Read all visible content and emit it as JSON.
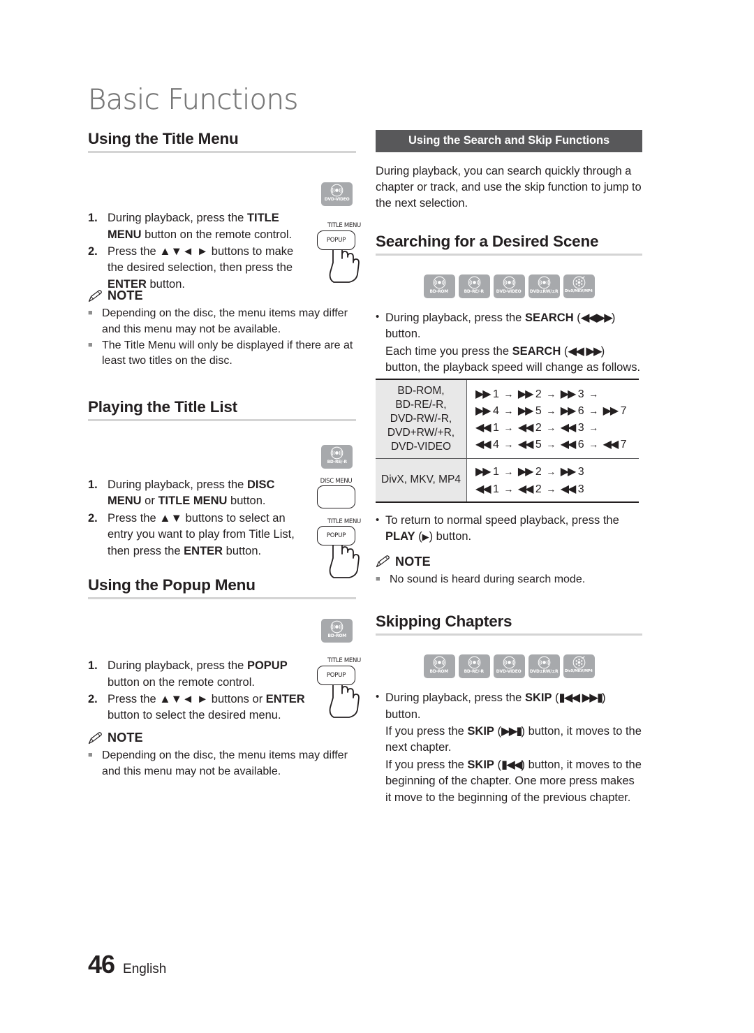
{
  "chapter": {
    "title": "Basic Functions"
  },
  "footer": {
    "page_number": "46",
    "language": "English"
  },
  "left_column": {
    "section1": {
      "heading": "Using the Title Menu",
      "disc_badge": {
        "caption": "DVD-VIDEO",
        "icon": "disc-icon"
      },
      "remote": {
        "cap": "TITLE MENU",
        "key_label": "POPUP",
        "icon": "hand-pressing-button-icon"
      },
      "steps": [
        {
          "num": "1.",
          "parts": [
            {
              "t": "During playback, press the "
            },
            {
              "t": "TITLE MENU",
              "b": true
            },
            {
              "t": " button on the remote control."
            }
          ]
        },
        {
          "num": "2.",
          "parts": [
            {
              "t": "Press the "
            },
            {
              "t": "▲▼◄ ►",
              "b": true
            },
            {
              "t": " buttons to make the desired selection, then press the "
            },
            {
              "t": "ENTER",
              "b": true
            },
            {
              "t": " button."
            }
          ]
        }
      ],
      "note": {
        "label": "NOTE",
        "icon": "pencil-icon",
        "items": [
          "Depending on the disc, the menu items may differ and this menu may not be available.",
          "The Title Menu will only be displayed if there are at least two titles on the disc."
        ]
      }
    },
    "section2": {
      "heading": "Playing the Title List",
      "disc_badge": {
        "caption": "BD-RE/-R",
        "icon": "disc-icon"
      },
      "remote_disc": {
        "cap": "DISC MENU",
        "key_label": ""
      },
      "remote_title": {
        "cap": "TITLE MENU",
        "key_label": "POPUP",
        "icon": "hand-pressing-button-icon"
      },
      "steps": [
        {
          "num": "1.",
          "parts": [
            {
              "t": "During playback, press the "
            },
            {
              "t": "DISC MENU",
              "b": true
            },
            {
              "t": " or "
            },
            {
              "t": "TITLE MENU",
              "b": true
            },
            {
              "t": " button."
            }
          ]
        },
        {
          "num": "2.",
          "parts": [
            {
              "t": "Press the "
            },
            {
              "t": "▲▼",
              "b": true
            },
            {
              "t": " buttons to select an entry you want to play from Title List, then press the "
            },
            {
              "t": "ENTER",
              "b": true
            },
            {
              "t": " button."
            }
          ]
        }
      ]
    },
    "section3": {
      "heading": "Using the Popup Menu",
      "disc_badge": {
        "caption": "BD-ROM",
        "icon": "disc-icon"
      },
      "remote": {
        "cap": "TITLE MENU",
        "key_label": "POPUP",
        "icon": "hand-pressing-button-icon"
      },
      "steps": [
        {
          "num": "1.",
          "parts": [
            {
              "t": "During playback, press the "
            },
            {
              "t": "POPUP",
              "b": true
            },
            {
              "t": " button on the remote control."
            }
          ]
        },
        {
          "num": "2.",
          "parts": [
            {
              "t": "Press the "
            },
            {
              "t": "▲▼◄ ►",
              "b": true
            },
            {
              "t": " buttons or "
            },
            {
              "t": "ENTER",
              "b": true
            },
            {
              "t": " button to select the desired menu."
            }
          ]
        }
      ],
      "note": {
        "label": "NOTE",
        "icon": "pencil-icon",
        "items": [
          "Depending on the disc, the menu items may differ and this menu may not be available."
        ]
      }
    }
  },
  "right_column": {
    "bar_heading": "Using the Search and Skip Functions",
    "intro": "During playback, you can search quickly through a chapter or track, and use the skip function to jump to the next selection.",
    "section_search": {
      "heading": "Searching for a Desired Scene",
      "disc_badges": [
        {
          "caption": "BD-ROM",
          "icon": "disc-icon"
        },
        {
          "caption": "BD-RE/-R",
          "icon": "disc-icon"
        },
        {
          "caption": "DVD-VIDEO",
          "icon": "disc-icon"
        },
        {
          "caption": "DVD±RW/±R",
          "icon": "disc-icon"
        },
        {
          "caption": "DivX/MKV/MP4",
          "icon": "divx-disc-icon"
        }
      ],
      "bullets": [
        {
          "parts": [
            {
              "t": "During playback, press the "
            },
            {
              "t": "SEARCH",
              "b": true
            },
            {
              "t": " (◄◄►►) button."
            }
          ]
        },
        {
          "parts": [
            {
              "t": "Each time you press the "
            },
            {
              "t": "SEARCH",
              "b": true
            },
            {
              "t": " (◄◄ ►►) button, the playback speed will change as follows."
            }
          ],
          "nomark": true
        }
      ],
      "after_table": [
        {
          "parts": [
            {
              "t": "To return to normal speed playback, press the "
            },
            {
              "t": "PLAY",
              "b": true
            },
            {
              "t": " (►) button."
            }
          ]
        }
      ],
      "note": {
        "label": "NOTE",
        "icon": "pencil-icon",
        "items": [
          "No sound is heard during search mode."
        ]
      }
    },
    "section_skip": {
      "heading": "Skipping Chapters",
      "disc_badges": [
        {
          "caption": "BD-ROM",
          "icon": "disc-icon"
        },
        {
          "caption": "BD-RE/-R",
          "icon": "disc-icon"
        },
        {
          "caption": "DVD-VIDEO",
          "icon": "disc-icon"
        },
        {
          "caption": "DVD±RW/±R",
          "icon": "disc-icon"
        },
        {
          "caption": "DivX/MKV/MP4",
          "icon": "divx-disc-icon"
        }
      ],
      "bullets": [
        {
          "parts": [
            {
              "t": "During playback, press the "
            },
            {
              "t": "SKIP",
              "b": true
            },
            {
              "t": " (I◄◄ ►►I) button."
            }
          ]
        },
        {
          "parts": [
            {
              "t": "If you press the "
            },
            {
              "t": "SKIP",
              "b": true
            },
            {
              "t": " (►►I) button, it moves to the next chapter."
            }
          ],
          "nomark": true
        },
        {
          "parts": [
            {
              "t": "If you press the "
            },
            {
              "t": "SKIP",
              "b": true
            },
            {
              "t": " (I◄◄) button, it moves to the beginning of the chapter. One more press makes it move to the beginning of the previous chapter."
            }
          ],
          "nomark": true
        }
      ]
    }
  },
  "speed_table": {
    "rows": [
      {
        "media": "BD-ROM,\nBD-RE/-R,\nDVD-RW/-R,\nDVD+RW/+R,\nDVD-VIDEO",
        "sequences": [
          {
            "dir": "ff",
            "steps": [
              "1",
              "2",
              "3"
            ],
            "trailing_arrow": true
          },
          {
            "dir": "ff",
            "steps": [
              "4",
              "5",
              "6",
              "7"
            ],
            "trailing_arrow": false
          },
          {
            "dir": "rw",
            "steps": [
              "1",
              "2",
              "3"
            ],
            "trailing_arrow": true
          },
          {
            "dir": "rw",
            "steps": [
              "4",
              "5",
              "6",
              "7"
            ],
            "trailing_arrow": false
          }
        ]
      },
      {
        "media": "DivX, MKV, MP4",
        "sequences": [
          {
            "dir": "ff",
            "steps": [
              "1",
              "2",
              "3"
            ],
            "trailing_arrow": false
          },
          {
            "dir": "rw",
            "steps": [
              "1",
              "2",
              "3"
            ],
            "trailing_arrow": false
          }
        ]
      }
    ]
  }
}
